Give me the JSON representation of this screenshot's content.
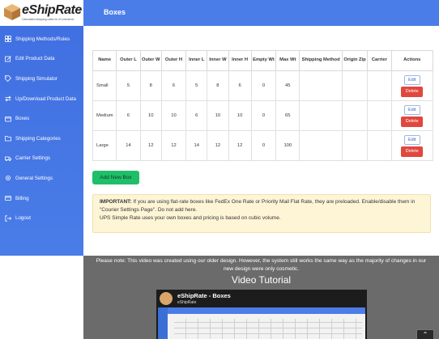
{
  "brand": {
    "name": "eShipRate",
    "tagline": "Calculated shipping rates for eCommerce"
  },
  "header": {
    "title": "Boxes"
  },
  "sidebar": {
    "items": [
      {
        "label": "Shipping Methods/Rules",
        "icon": "grid-icon"
      },
      {
        "label": "Edit Product Data",
        "icon": "edit-icon"
      },
      {
        "label": "Shipping Simulator",
        "icon": "tag-icon"
      },
      {
        "label": "Up/Download Product Data",
        "icon": "swap-icon"
      },
      {
        "label": "Boxes",
        "icon": "box-icon"
      },
      {
        "label": "Shipping Categories",
        "icon": "folder-icon"
      },
      {
        "label": "Carrier Settings",
        "icon": "truck-icon"
      },
      {
        "label": "General Settings",
        "icon": "gear-icon"
      },
      {
        "label": "Billing",
        "icon": "card-icon"
      },
      {
        "label": "Logout",
        "icon": "logout-icon"
      }
    ]
  },
  "table": {
    "columns": [
      "Name",
      "Outer L",
      "Outer W",
      "Outer H",
      "Inner L",
      "Inner W",
      "Inner H",
      "Empty Wt",
      "Max Wt",
      "Shipping Method",
      "Origin Zip",
      "Carrier",
      "Actions"
    ],
    "rows": [
      {
        "name": "Small",
        "outer_l": "5",
        "outer_w": "8",
        "outer_h": "6",
        "inner_l": "5",
        "inner_w": "8",
        "inner_h": "6",
        "empty_wt": "0",
        "max_wt": "45",
        "shipping_method": "",
        "origin_zip": "",
        "carrier": ""
      },
      {
        "name": "Medium",
        "outer_l": "6",
        "outer_w": "10",
        "outer_h": "10",
        "inner_l": "6",
        "inner_w": "10",
        "inner_h": "10",
        "empty_wt": "0",
        "max_wt": "65",
        "shipping_method": "",
        "origin_zip": "",
        "carrier": ""
      },
      {
        "name": "Large",
        "outer_l": "14",
        "outer_w": "12",
        "outer_h": "12",
        "inner_l": "14",
        "inner_w": "12",
        "inner_h": "12",
        "empty_wt": "0",
        "max_wt": "100",
        "shipping_method": "",
        "origin_zip": "",
        "carrier": ""
      }
    ],
    "edit_label": "Edit",
    "delete_label": "Delete"
  },
  "add_button": {
    "label": "Add New Box"
  },
  "notice": {
    "important": "IMPORTANT:",
    "line1": " If you are using flat-rate boxes like FedEx One Rate or Priority Mail Flat Rate, they are preloaded. Enable/disable them in \"Courier Settings Page\". Do not add here.",
    "line2": "UPS Simple Rate uses your own boxes and pricing is based on cubic volume."
  },
  "video": {
    "note": "Please note: This video was created using our older design. However, the system still works the same way as the majority of changes in our new design were only cosmetic.",
    "heading": "Video Tutorial",
    "player_title": "eShipRate - Boxes",
    "player_channel": "eShipRate"
  },
  "colors": {
    "primary": "#4a7de8",
    "add": "#1fbf6a",
    "delete": "#e0483e",
    "notice_bg": "#fdf5d6"
  }
}
